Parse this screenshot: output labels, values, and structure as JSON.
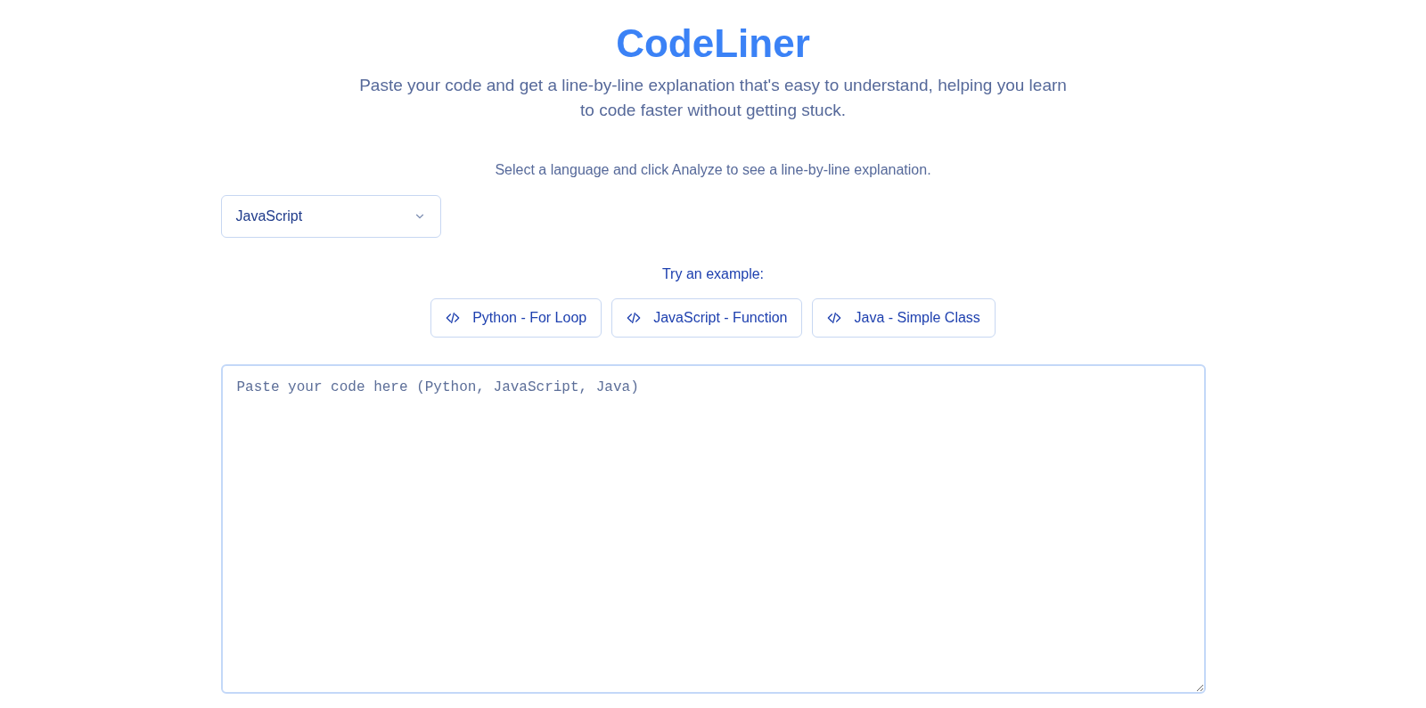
{
  "header": {
    "title": "CodeLiner",
    "subtitle": "Paste your code and get a line-by-line explanation that's easy to understand, helping you learn to code faster without getting stuck."
  },
  "instruction": "Select a language and click Analyze to see a line-by-line explanation.",
  "language_select": {
    "value": "JavaScript"
  },
  "examples": {
    "label": "Try an example:",
    "buttons": [
      "Python - For Loop",
      "JavaScript - Function",
      "Java - Simple Class"
    ]
  },
  "code_editor": {
    "placeholder": "Paste your code here (Python, JavaScript, Java)"
  }
}
